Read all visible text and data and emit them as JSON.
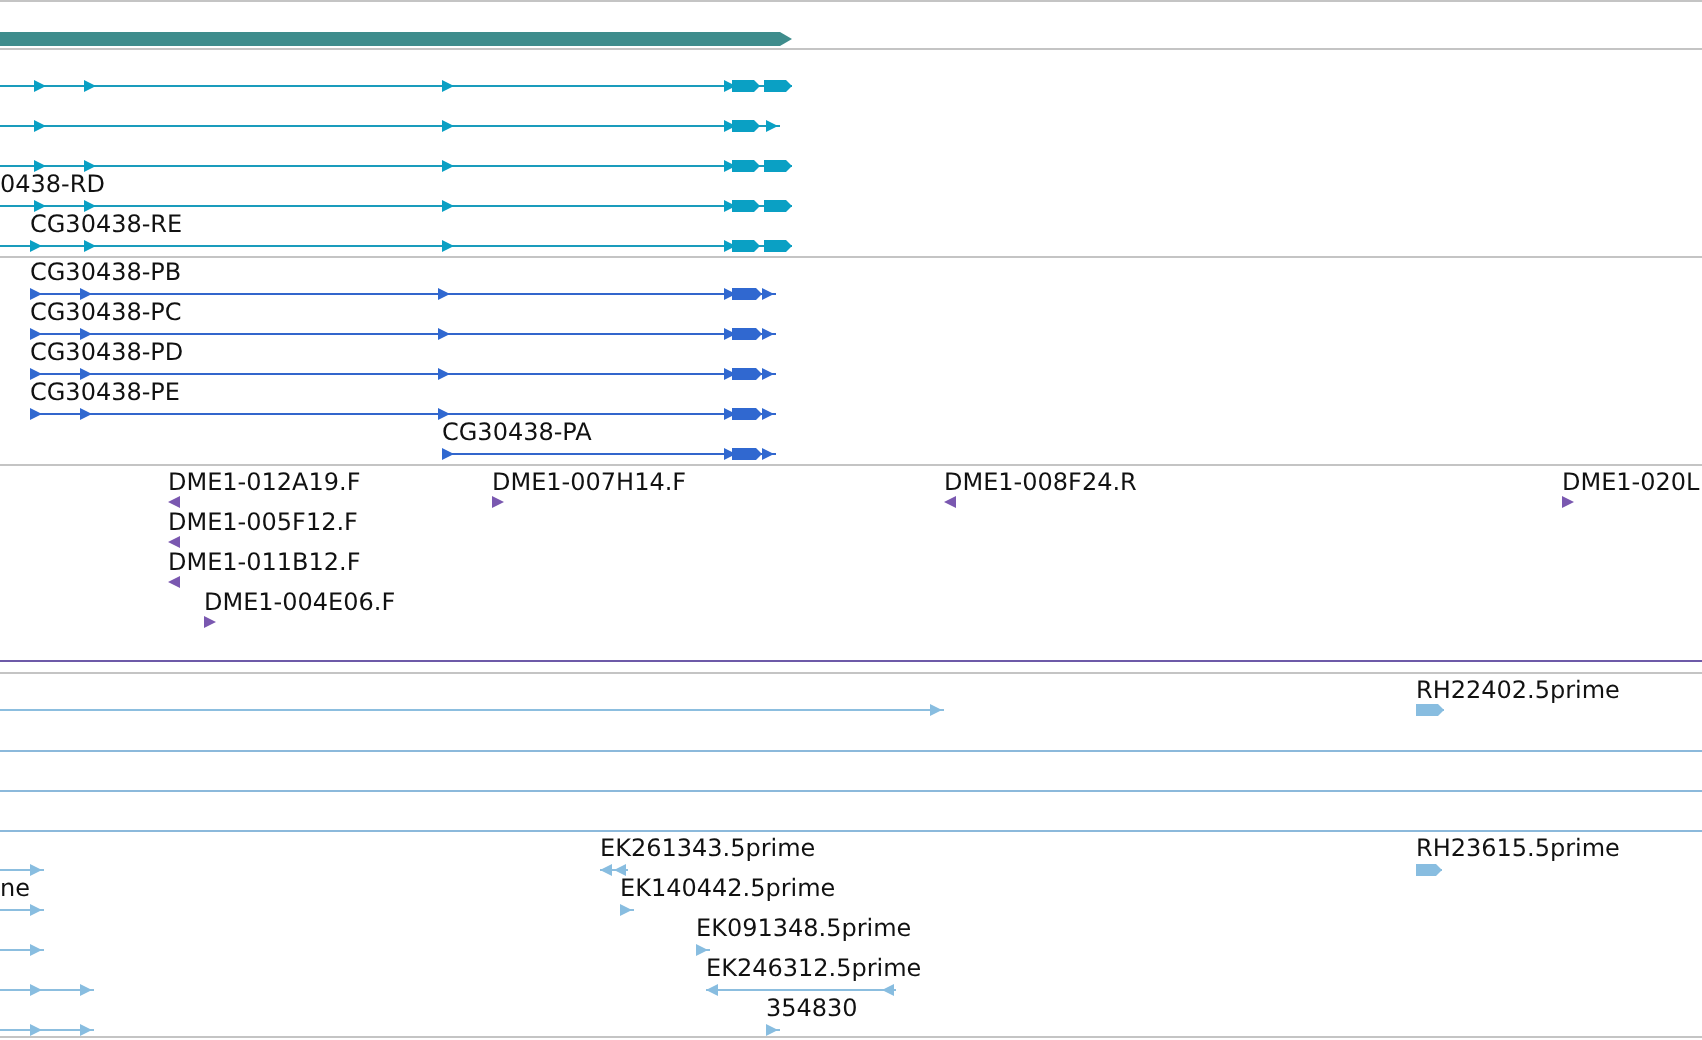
{
  "transcript_track_1": {
    "labels": [
      "0438-RD",
      "CG30438-RE"
    ]
  },
  "transcript_track_2": {
    "labels": [
      "CG30438-PB",
      "CG30438-PC",
      "CG30438-PD",
      "CG30438-PE",
      "CG30438-PA"
    ]
  },
  "est_track": {
    "labels": [
      "DME1-012A19.F",
      "DME1-005F12.F",
      "DME1-011B12.F",
      "DME1-004E06.F",
      "DME1-007H14.F",
      "DME1-008F24.R",
      "DME1-020L"
    ]
  },
  "cdna_track_1": {
    "labels": [
      "RH22402.5prime"
    ]
  },
  "cdna_track_2": {
    "labels": [
      "ne",
      "EK261343.5prime",
      "EK140442.5prime",
      "EK091348.5prime",
      "EK246312.5prime",
      "354830",
      "RH23615.5prime"
    ]
  }
}
